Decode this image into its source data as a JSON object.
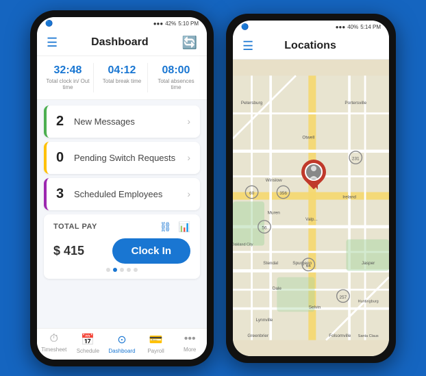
{
  "leftPhone": {
    "statusBar": {
      "time": "5:10 PM",
      "battery": "42%",
      "signal": "●●●"
    },
    "topNav": {
      "title": "Dashboard",
      "leftIconName": "menu-icon",
      "rightIconName": "refresh-icon"
    },
    "stats": [
      {
        "value": "32:48",
        "label": "Total clock in/\nOut time"
      },
      {
        "value": "04:12",
        "label": "Total break\ntime"
      },
      {
        "value": "08:00",
        "label": "Total absences\ntime"
      }
    ],
    "cards": [
      {
        "number": "2",
        "text": "New Messages",
        "borderColor": "#4CAF50"
      },
      {
        "number": "0",
        "text": "Pending Switch Requests",
        "borderColor": "#FFC107"
      },
      {
        "number": "3",
        "text": "Scheduled Employees",
        "borderColor": "#9C27B0"
      }
    ],
    "totalPay": {
      "label": "TOTAL PAY",
      "amount": "$ 415",
      "clockInButton": "Clock In"
    },
    "bottomNav": [
      {
        "label": "Timesheet",
        "icon": "⏱",
        "active": false
      },
      {
        "label": "Schedule",
        "icon": "📅",
        "active": false
      },
      {
        "label": "Dashboard",
        "icon": "⊙",
        "active": true
      },
      {
        "label": "Payroll",
        "icon": "💳",
        "active": false
      },
      {
        "label": "More",
        "icon": "···",
        "active": false
      }
    ]
  },
  "rightPhone": {
    "statusBar": {
      "time": "5:14 PM",
      "battery": "40%",
      "signal": "●●●"
    },
    "topNav": {
      "title": "Locations",
      "leftIconName": "menu-icon"
    },
    "map": {
      "pinLabel": "person-location-pin"
    }
  },
  "colors": {
    "brand": "#1976D2",
    "background": "#1565C0",
    "cardBorder": {
      "messages": "#4CAF50",
      "switch": "#FFC107",
      "scheduled": "#9C27B0"
    }
  }
}
